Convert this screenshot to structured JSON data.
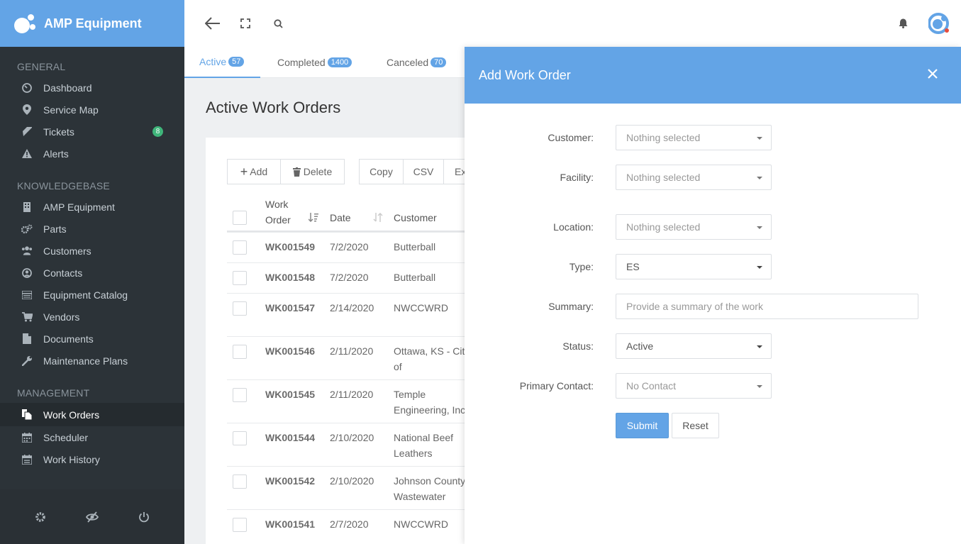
{
  "app": {
    "title": "AMP Equipment"
  },
  "sidebar": {
    "sections": [
      {
        "title": "GENERAL",
        "items": [
          {
            "label": "Dashboard",
            "icon": "dashboard-icon"
          },
          {
            "label": "Service Map",
            "icon": "map-marker-icon"
          },
          {
            "label": "Tickets",
            "icon": "ticket-icon",
            "badge": "8"
          },
          {
            "label": "Alerts",
            "icon": "warning-icon"
          }
        ]
      },
      {
        "title": "KNOWLEDGEBASE",
        "items": [
          {
            "label": "AMP Equipment",
            "icon": "building-icon"
          },
          {
            "label": "Parts",
            "icon": "gears-icon"
          },
          {
            "label": "Customers",
            "icon": "users-icon"
          },
          {
            "label": "Contacts",
            "icon": "user-circle-icon"
          },
          {
            "label": "Equipment Catalog",
            "icon": "catalog-icon"
          },
          {
            "label": "Vendors",
            "icon": "cart-icon"
          },
          {
            "label": "Documents",
            "icon": "document-icon"
          },
          {
            "label": "Maintenance Plans",
            "icon": "wrench-icon"
          }
        ]
      },
      {
        "title": "MANAGEMENT",
        "items": [
          {
            "label": "Work Orders",
            "icon": "files-icon",
            "active": true
          },
          {
            "label": "Scheduler",
            "icon": "calendar-icon"
          },
          {
            "label": "Work History",
            "icon": "calendar-check-icon"
          }
        ]
      }
    ],
    "footer_icons": [
      "gear-icon",
      "eye-slash-icon",
      "power-icon"
    ]
  },
  "tabs": [
    {
      "label": "Active",
      "count": "57",
      "active": true
    },
    {
      "label": "Completed",
      "count": "1400"
    },
    {
      "label": "Canceled",
      "count": "70"
    }
  ],
  "page": {
    "title": "Active Work Orders"
  },
  "toolbar": {
    "add_label": "Add",
    "delete_label": "Delete",
    "copy_label": "Copy",
    "csv_label": "CSV",
    "excel_label": "Ex"
  },
  "table": {
    "headers": {
      "work_order_line1": "Work",
      "work_order_line2": "Order",
      "date": "Date",
      "customer": "Customer"
    },
    "rows": [
      {
        "wo": "WK001549",
        "date": "7/2/2020",
        "customer": "Butterball"
      },
      {
        "wo": "WK001548",
        "date": "7/2/2020",
        "customer": "Butterball"
      },
      {
        "wo": "WK001547",
        "date": "2/14/2020",
        "customer": "NWCCWRD"
      },
      {
        "wo": "WK001546",
        "date": "2/11/2020",
        "customer": "Ottawa, KS - City of"
      },
      {
        "wo": "WK001545",
        "date": "2/11/2020",
        "customer": "Temple Engineering, Inc."
      },
      {
        "wo": "WK001544",
        "date": "2/10/2020",
        "customer": "National Beef Leathers"
      },
      {
        "wo": "WK001542",
        "date": "2/10/2020",
        "customer": "Johnson County Wastewater"
      },
      {
        "wo": "WK001541",
        "date": "2/7/2020",
        "customer": "NWCCWRD"
      }
    ]
  },
  "modal": {
    "title": "Add Work Order",
    "fields": {
      "customer": {
        "label": "Customer:",
        "value": "Nothing selected"
      },
      "facility": {
        "label": "Facility:",
        "value": "Nothing selected"
      },
      "location": {
        "label": "Location:",
        "value": "Nothing selected"
      },
      "type": {
        "label": "Type:",
        "value": "ES"
      },
      "summary": {
        "label": "Summary:",
        "placeholder": "Provide a summary of the work"
      },
      "status": {
        "label": "Status:",
        "value": "Active"
      },
      "primary_contact": {
        "label": "Primary Contact:",
        "value": "No Contact"
      }
    },
    "submit_label": "Submit",
    "reset_label": "Reset"
  },
  "colors": {
    "accent": "#63a4e6",
    "sidebar_bg": "#2c3338",
    "badge_green": "#3fb57a"
  }
}
